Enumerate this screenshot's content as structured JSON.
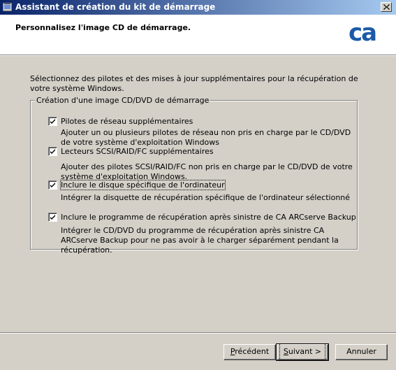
{
  "window": {
    "title": "Assistant de création du kit de démarrage",
    "close_glyph": "X"
  },
  "header": {
    "title": "Personnalisez l'image CD de démarrage.",
    "logo_text": "ca",
    "logo_color": "#1c5aa8"
  },
  "main": {
    "intro": "Sélectionnez des pilotes et des mises à jour supplémentaires pour la récupération de votre système Windows.",
    "group_title": "Création d'une image CD/DVD de démarrage",
    "options": [
      {
        "label": "Pilotes de réseau supplémentaires",
        "checked": true,
        "description": "Ajouter un ou plusieurs pilotes de réseau non pris en charge par le CD/DVD de votre système d'exploitation Windows"
      },
      {
        "label": "Lecteurs SCSI/RAID/FC supplémentaires",
        "checked": true,
        "description": "Ajouter des pilotes SCSI/RAID/FC non pris en charge par le CD/DVD de votre système d'exploitation Windows."
      },
      {
        "label": "Inclure le disque spécifique de l'ordinateur",
        "checked": true,
        "description": "Intégrer la disquette de récupération spécifique de l'ordinateur sélectionné"
      },
      {
        "label": "Inclure le programme de récupération après sinistre de CA ARCserve Backup",
        "checked": true,
        "description": "Intégrer le CD/DVD du programme de récupération après sinistre CA ARCserve Backup pour ne pas avoir à le charger séparément pendant la récupération."
      }
    ]
  },
  "footer": {
    "back_mnemonic": "P",
    "back_rest": "récédent",
    "next_mnemonic": "S",
    "next_rest": "uivant >",
    "cancel_label": "Annuler"
  }
}
